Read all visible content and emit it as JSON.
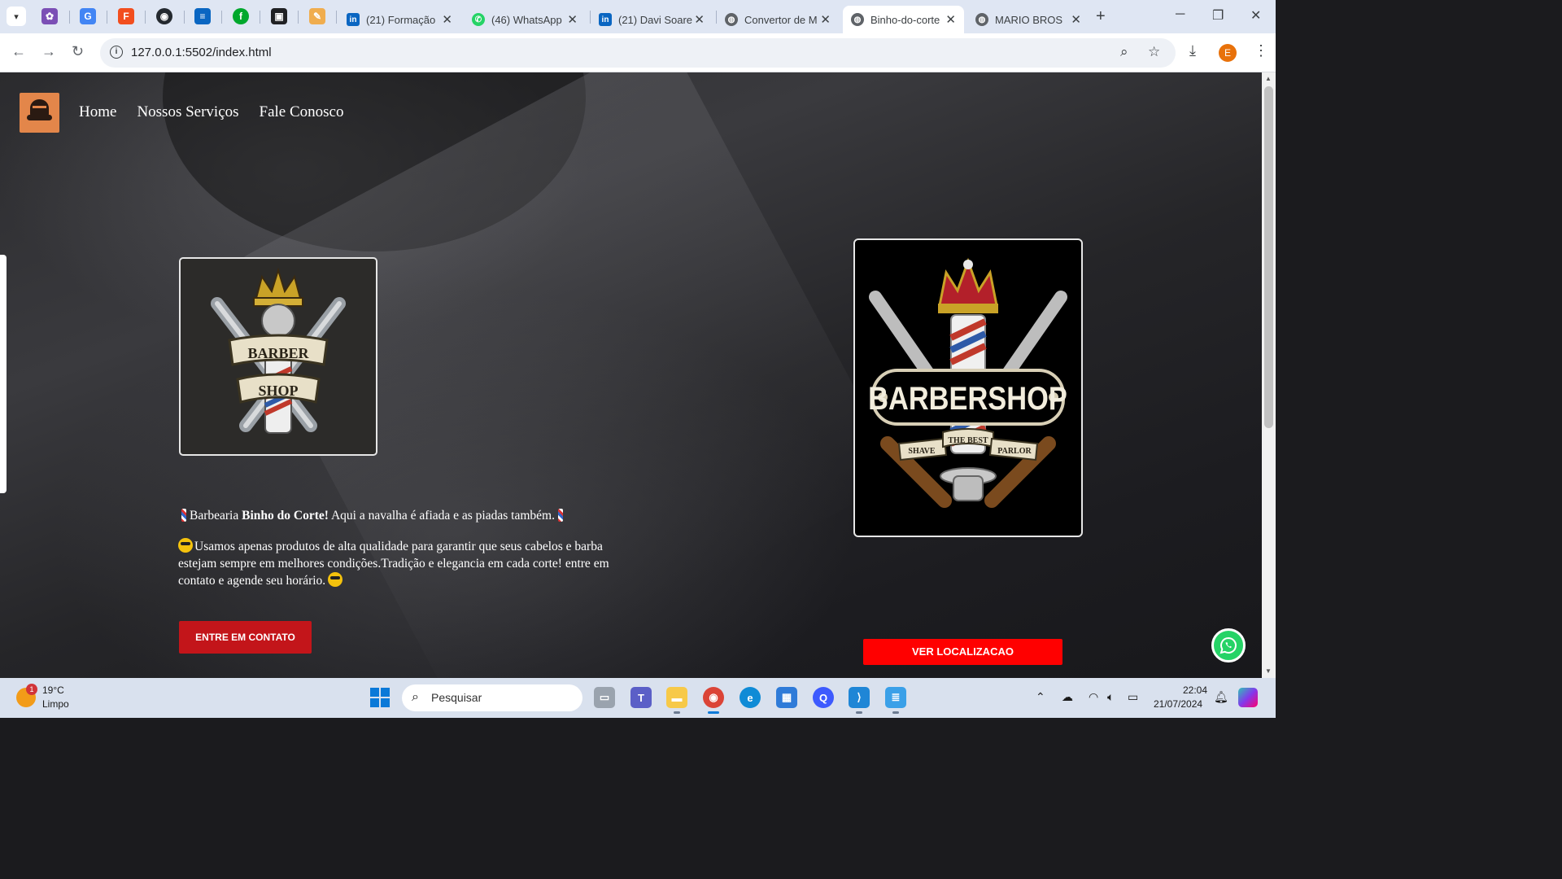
{
  "browser": {
    "tabs": [
      {
        "title": "(21) Formação",
        "icon": "linkedin-icon"
      },
      {
        "title": "(46) WhatsApp",
        "icon": "whatsapp-icon"
      },
      {
        "title": "(21) Davi Soare",
        "icon": "linkedin-icon"
      },
      {
        "title": "Convertor de M",
        "icon": "globe-icon"
      },
      {
        "title": "Binho-do-corte",
        "icon": "globe-icon",
        "active": true
      },
      {
        "title": "MARIO BROS",
        "icon": "globe-icon"
      }
    ],
    "url": "127.0.0.1:5502/index.html",
    "profile_initial": "E"
  },
  "site": {
    "nav": [
      "Home",
      "Nossos Serviços",
      "Fale Conosco"
    ],
    "intro_prefix": "Barbearia ",
    "intro_bold": "Binho do Corte!",
    "intro_suffix": " Aqui a navalha é afiada e as piadas também.",
    "description": "Usamos apenas produtos de alta qualidade para garantir que seus cabelos e barba estejam sempre em melhores condições.Tradição e elegancia em cada corte! entre em contato e agende seu horário.",
    "contact_button": "ENTRE EM CONTATO",
    "location_button": "VER LOCALIZACAO",
    "logo_small": {
      "line1": "BARBER",
      "line2": "SHOP"
    },
    "logo_big": {
      "title": "BARBERSHOP",
      "left": "SHAVE",
      "center": "THE BEST",
      "right": "PARLOR"
    }
  },
  "taskbar": {
    "weather_temp": "19°C",
    "weather_desc": "Limpo",
    "weather_badge": "1",
    "search_placeholder": "Pesquisar",
    "time": "22:04",
    "date": "21/07/2024"
  },
  "colors": {
    "contact_button": "#c3151a",
    "location_button": "#ff0000",
    "whatsapp": "#25d366"
  }
}
